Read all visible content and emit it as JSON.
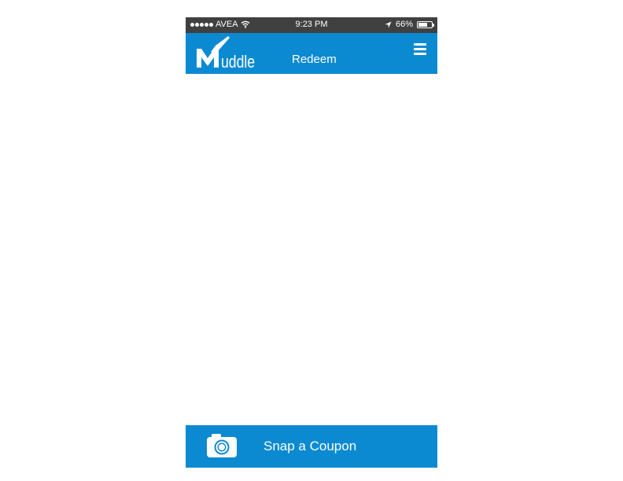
{
  "status_bar": {
    "carrier": "AVEA",
    "time": "9:23 PM",
    "battery_percent": "66%",
    "battery_level": 0.66,
    "icons": [
      "signal-dots-icon",
      "wifi-icon",
      "location-arrow-icon",
      "battery-icon"
    ]
  },
  "header": {
    "logo_text": "uddle",
    "title": "Redeem",
    "menu_icon": "hamburger-menu-icon",
    "background": "#0b8ad2"
  },
  "bottom_action": {
    "label": "Snap a Coupon",
    "icon": "camera-icon",
    "background": "#0b8ad2"
  }
}
